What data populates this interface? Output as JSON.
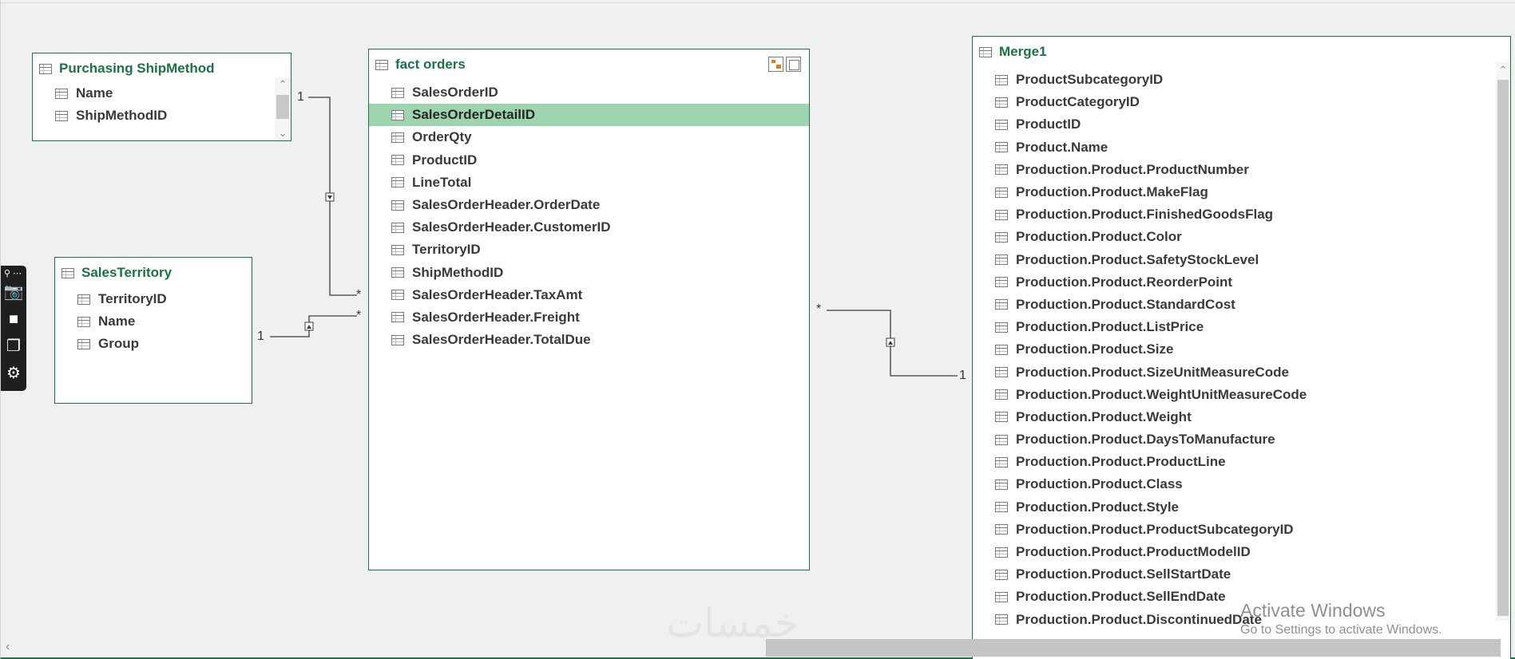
{
  "tables": {
    "purchasing_shipmethod": {
      "title": "Purchasing ShipMethod",
      "fields": [
        "Name",
        "ShipMethodID"
      ]
    },
    "sales_territory": {
      "title": "SalesTerritory",
      "fields": [
        "TerritoryID",
        "Name",
        "Group"
      ]
    },
    "fact_orders": {
      "title": "fact orders",
      "selected_field": "SalesOrderDetailID",
      "fields": [
        "SalesOrderID",
        "SalesOrderDetailID",
        "OrderQty",
        "ProductID",
        "LineTotal",
        "SalesOrderHeader.OrderDate",
        "SalesOrderHeader.CustomerID",
        "TerritoryID",
        "ShipMethodID",
        "SalesOrderHeader.TaxAmt",
        "SalesOrderHeader.Freight",
        "SalesOrderHeader.TotalDue"
      ]
    },
    "merge1": {
      "title": "Merge1",
      "fields": [
        "ProductSubcategoryID",
        "ProductCategoryID",
        "ProductID",
        "Product.Name",
        "Production.Product.ProductNumber",
        "Production.Product.MakeFlag",
        "Production.Product.FinishedGoodsFlag",
        "Production.Product.Color",
        "Production.Product.SafetyStockLevel",
        "Production.Product.ReorderPoint",
        "Production.Product.StandardCost",
        "Production.Product.ListPrice",
        "Production.Product.Size",
        "Production.Product.SizeUnitMeasureCode",
        "Production.Product.WeightUnitMeasureCode",
        "Production.Product.Weight",
        "Production.Product.DaysToManufacture",
        "Production.Product.ProductLine",
        "Production.Product.Class",
        "Production.Product.Style",
        "Production.Product.ProductSubcategoryID",
        "Production.Product.ProductModelID",
        "Production.Product.SellStartDate",
        "Production.Product.SellEndDate",
        "Production.Product.DiscontinuedDate"
      ]
    }
  },
  "relationships": {
    "shipmethod_to_orders": {
      "one": "1",
      "many": "*"
    },
    "territory_to_orders": {
      "one": "1",
      "many": "*"
    },
    "orders_to_merge1": {
      "many": "*",
      "one": "1"
    }
  },
  "icons": {
    "field": "table-field-icon",
    "table": "table-icon",
    "layout": "diagram-layout-icon",
    "window": "restore-window-icon",
    "camera": "camera-icon",
    "video": "video-camera-icon",
    "windows": "windows-stack-icon",
    "settings": "gear-icon"
  },
  "watermark": {
    "title": "Activate Windows",
    "subtitle": "Go to Settings to activate Windows.",
    "logo_text": "خمسات"
  },
  "colors": {
    "table_border": "#1e7145",
    "table_title": "#1e7145",
    "selected_row": "#9fd4b1",
    "canvas": "#f0f0f0"
  }
}
